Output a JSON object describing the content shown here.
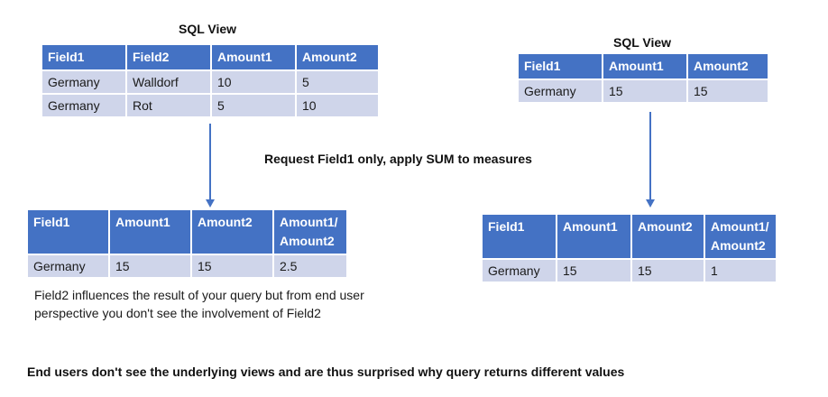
{
  "left": {
    "title": "SQL View",
    "source_table": {
      "headers": [
        "Field1",
        "Field2",
        "Amount1",
        "Amount2"
      ],
      "rows": [
        [
          "Germany",
          "Walldorf",
          "10",
          "5"
        ],
        [
          "Germany",
          "Rot",
          "5",
          "10"
        ]
      ]
    },
    "result_table": {
      "headers": [
        "Field1",
        "Amount1",
        "Amount2",
        "Amount1/\nAmount2"
      ],
      "rows": [
        [
          "Germany",
          "15",
          "15",
          "2.5"
        ]
      ]
    },
    "note": "Field2 influences the result of your query but from end user perspective you don't see the involvement of Field2"
  },
  "right": {
    "title": "SQL View",
    "source_table": {
      "headers": [
        "Field1",
        "Amount1",
        "Amount2"
      ],
      "rows": [
        [
          "Germany",
          "15",
          "15"
        ]
      ]
    },
    "result_table": {
      "headers": [
        "Field1",
        "Amount1",
        "Amount2",
        "Amount1/\nAmount2"
      ],
      "rows": [
        [
          "Germany",
          "15",
          "15",
          "1"
        ]
      ]
    }
  },
  "middle_label": "Request Field1 only, apply SUM to measures",
  "footer": "End users don't see the underlying views and are thus surprised why query returns different values",
  "colors": {
    "header": "#4472c4",
    "cell": "#cfd5ea",
    "arrow": "#4472c4"
  }
}
